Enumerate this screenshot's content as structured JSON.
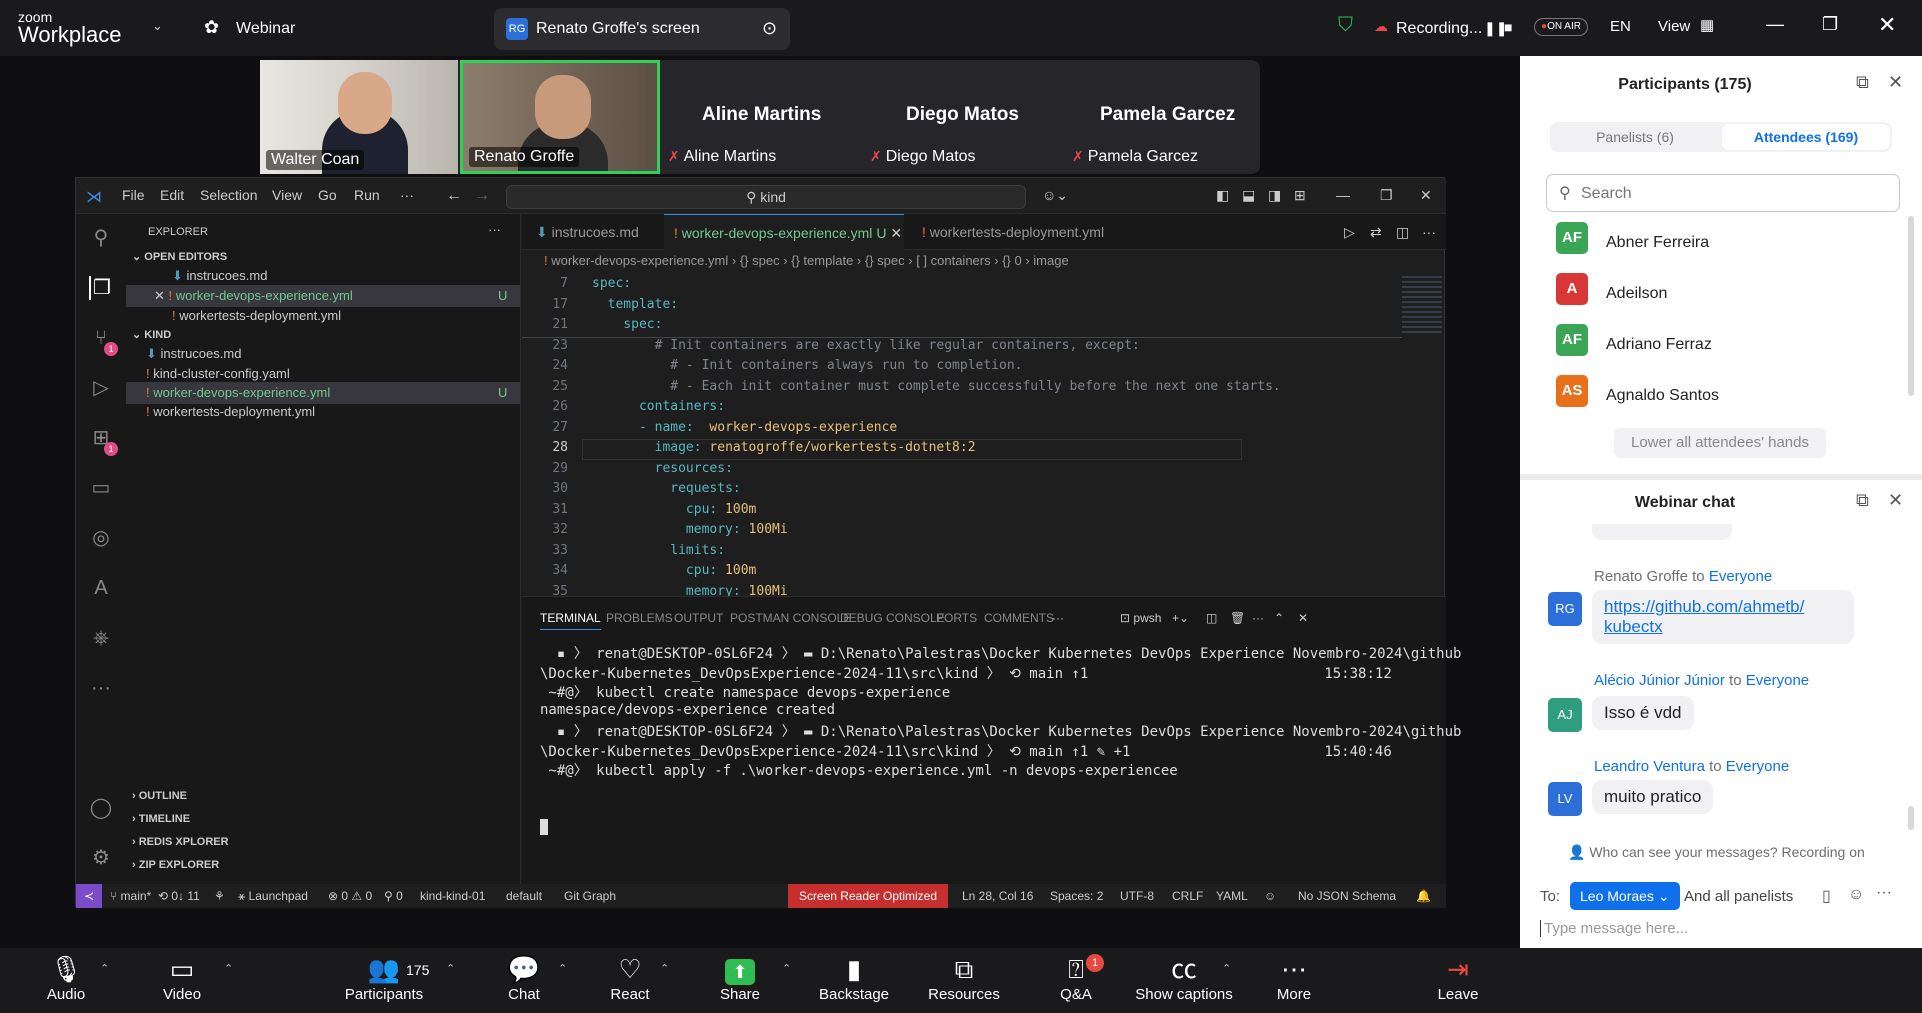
{
  "app": {
    "brand_top": "zoom",
    "brand_bottom": "Workplace",
    "mode": "Webinar"
  },
  "share": {
    "initials": "RG",
    "label": "Renato Groffe's screen"
  },
  "topright": {
    "recording": "Recording...",
    "on_air": "ON AIR",
    "lang": "EN",
    "view": "View"
  },
  "videos": [
    {
      "name": "Walter Coan"
    },
    {
      "name": "Renato Groffe"
    }
  ],
  "panelists_strip": [
    {
      "name": "Aline Martins",
      "label": "Aline Martins"
    },
    {
      "name": "Diego Matos",
      "label": "Diego Matos"
    },
    {
      "name": "Pamela Garcez",
      "label": "Pamela Garcez"
    }
  ],
  "vscode": {
    "menu": [
      "File",
      "Edit",
      "Selection",
      "View",
      "Go",
      "Run",
      "···"
    ],
    "search": "kind",
    "explorer_title": "EXPLORER",
    "open_editors_title": "OPEN EDITORS",
    "open_editors": [
      {
        "name": "instrucoes.md",
        "badge": ""
      },
      {
        "name": "worker-devops-experience.yml",
        "badge": "U"
      },
      {
        "name": "workertests-deployment.yml",
        "badge": ""
      }
    ],
    "folder_title": "KIND",
    "folder_files": [
      {
        "name": "instrucoes.md",
        "badge": ""
      },
      {
        "name": "kind-cluster-config.yaml",
        "badge": ""
      },
      {
        "name": "worker-devops-experience.yml",
        "badge": "U"
      },
      {
        "name": "workertests-deployment.yml",
        "badge": ""
      }
    ],
    "outline_sections": [
      "OUTLINE",
      "TIMELINE",
      "REDIS XPLORER",
      "ZIP EXPLORER"
    ],
    "tabs": [
      {
        "label": "instrucoes.md"
      },
      {
        "label": "worker-devops-experience.yml",
        "suffix": "U"
      },
      {
        "label": "workertests-deployment.yml"
      }
    ],
    "breadcrumb": [
      "worker-devops-experience.yml",
      "{} spec",
      "{} template",
      "{} spec",
      "[ ] containers",
      "{} 0",
      "image"
    ],
    "code": [
      {
        "n": "7",
        "indent": "",
        "key": "spec:",
        "val": ""
      },
      {
        "n": "17",
        "indent": "  ",
        "key": "template:",
        "val": ""
      },
      {
        "n": "21",
        "indent": "    ",
        "key": "spec:",
        "val": ""
      },
      {
        "n": "23",
        "indent": "        ",
        "comment": "# Init containers are exactly like regular containers, except:"
      },
      {
        "n": "24",
        "indent": "          ",
        "comment": "# - Init containers always run to completion."
      },
      {
        "n": "25",
        "indent": "          ",
        "comment": "# - Each init container must complete successfully before the next one starts."
      },
      {
        "n": "26",
        "indent": "      ",
        "key": "containers:",
        "val": ""
      },
      {
        "n": "27",
        "indent": "      ",
        "key": "- name:",
        "val": "  worker-devops-experience"
      },
      {
        "n": "28",
        "indent": "        ",
        "key": "image:",
        "val": " renatogroffe/workertests-dotnet8:2"
      },
      {
        "n": "29",
        "indent": "        ",
        "key": "resources:",
        "val": ""
      },
      {
        "n": "30",
        "indent": "          ",
        "key": "requests:",
        "val": ""
      },
      {
        "n": "31",
        "indent": "            ",
        "key": "cpu:",
        "val": " 100m"
      },
      {
        "n": "32",
        "indent": "            ",
        "key": "memory:",
        "val": " 100Mi"
      },
      {
        "n": "33",
        "indent": "          ",
        "key": "limits:",
        "val": ""
      },
      {
        "n": "34",
        "indent": "            ",
        "key": "cpu:",
        "val": " 100m"
      },
      {
        "n": "35",
        "indent": "            ",
        "key": "memory:",
        "val": " 100Mi"
      }
    ],
    "panel_tabs": [
      "TERMINAL",
      "PROBLEMS",
      "OUTPUT",
      "POSTMAN CONSOLE",
      "DEBUG CONSOLE",
      "PORTS",
      "COMMENTS",
      "···"
    ],
    "shell": "pwsh",
    "terminal": [
      "  ▪ 〉 renat@DESKTOP-0SL6F24 〉 ▬ D:\\Renato\\Palestras\\Docker Kubernetes DevOps Experience Novembro-2024\\github",
      "\\Docker-Kubernetes_DevOpsExperience-2024-11\\src\\kind 〉 ⟲ main ↑1                            15:38:12",
      " ~#@〉 kubectl create namespace devops-experience",
      "namespace/devops-experience created",
      "  ▪ 〉 renat@DESKTOP-0SL6F24 〉 ▬ D:\\Renato\\Palestras\\Docker Kubernetes DevOps Experience Novembro-2024\\github",
      "\\Docker-Kubernetes_DevOpsExperience-2024-11\\src\\kind 〉 ⟲ main ↑1 ✎ +1                       15:40:46",
      " ~#@〉 kubectl apply -f .\\worker-devops-experience.yml -n devops-experiencee"
    ],
    "status": {
      "branch": "main*",
      "sync": "⟲ 0↓ 11",
      "launchpad": "Launchpad",
      "problems": "⊗ 0 ⚠ 0",
      "ports": "0",
      "cluster": "kind-kind-01",
      "namespace": "default",
      "git_graph": "Git Graph",
      "screen_reader": "Screen Reader Optimized",
      "position": "Ln 28, Col 16",
      "spaces": "Spaces: 2",
      "encoding": "UTF-8",
      "eol": "CRLF",
      "lang": "YAML",
      "schema": "No JSON Schema"
    }
  },
  "participants": {
    "title": "Participants (175)",
    "tab_panelists": "Panelists (6)",
    "tab_attendees": "Attendees (169)",
    "search_placeholder": "Search",
    "list": [
      {
        "initials": "AF",
        "name": "Abner Ferreira",
        "color": "#3aa655"
      },
      {
        "initials": "A",
        "name": "Adeilson",
        "color": "#d93737"
      },
      {
        "initials": "AF",
        "name": "Adriano Ferraz",
        "color": "#3aa655"
      },
      {
        "initials": "AS",
        "name": "Agnaldo Santos",
        "color": "#e8701a"
      }
    ],
    "lower_hands": "Lower all attendees' hands"
  },
  "chat": {
    "title": "Webinar chat",
    "messages": [
      {
        "from": "Renato Groffe",
        "to": "to",
        "audience": "Everyone",
        "initials": "RG",
        "color": "#2d6fd8",
        "text": "https://github.com/ahmetb/\nkubectx"
      },
      {
        "from": "Alécio Júnior Júnior",
        "to": "to",
        "audience": "Everyone",
        "initials": "AJ",
        "color": "#2f9e7e",
        "text": "Isso é vdd"
      },
      {
        "from": "Leandro Ventura",
        "to": "to",
        "audience": "Everyone",
        "initials": "LV",
        "color": "#2d6fd8",
        "text": "muito pratico"
      }
    ],
    "visibility_note": "Who can see your messages? Recording on",
    "to_label": "To:",
    "recipient": "Leo Moraes",
    "and_panelists": "And all panelists",
    "input_placeholder": "Type message here..."
  },
  "bottom": {
    "audio": "Audio",
    "video": "Video",
    "participants": "Participants",
    "participants_count": "175",
    "chat": "Chat",
    "react": "React",
    "share": "Share",
    "backstage": "Backstage",
    "resources": "Resources",
    "qa": "Q&A",
    "qa_badge": "1",
    "captions": "Show captions",
    "more": "More",
    "leave": "Leave"
  }
}
